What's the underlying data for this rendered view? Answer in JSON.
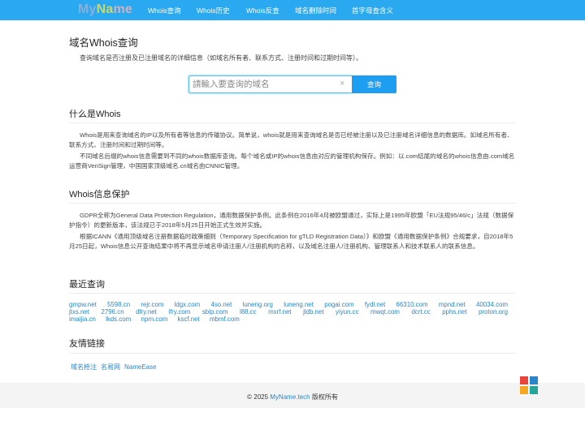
{
  "header": {
    "logo_parts": [
      "My",
      "Na",
      "me"
    ],
    "nav": [
      "Whois查询",
      "Whois历史",
      "Whois反查",
      "域名删除时间",
      "首字母查含义"
    ]
  },
  "page": {
    "title": "域名Whois查询",
    "description": "查询域名是否注册及已注册域名的详细信息（如域名所有者、联系方式、注册时间和过期时间等）。"
  },
  "search": {
    "placeholder": "請輸入要查询的域名",
    "value": "",
    "clear_glyph": "×",
    "button_label": "查询"
  },
  "about": {
    "title": "什么是Whois",
    "paragraphs": [
      "Whois是用来查询域名的IP以及所有者等信息的传输协议。简单说，whois就是用来查询域名是否已经被注册以及已注册域名详细信息的数据库。如域名所有者、联系方式、注册时间和过期时间等。",
      "不同域名后缀的whois信息需要到不同的whois数据库查询。每个域名或IP的whois信息由对应的管理机构保存。例如：以.com结尾的域名的whois信息由.com域名运营商VeriSign管理，中国国家顶级域名.cn域名由CNNIC管理。"
    ]
  },
  "privacy": {
    "title": "Whois信息保护",
    "paragraphs": [
      "GDPR全称为General Data Protection Regulation，通用数据保护条例。此条例在2016年4月被欧盟通过，实际上是1995年欧盟「EU法规95/46/c」法规（数据保护指令）的更新版本，该法规已于2018年5月25日开始正式生效并实施。",
      "根据ICANN《通用顶级域名注册数据临时政策细则（Temporary Specification for gTLD Registration Data）》和欧盟《通用数据保护条例》合规要求，自2018年5月25日起，Whois信息公开查询结果中将不再显示域名申请注册人/注册机构的名称，以及域名注册人/注册机构、管理联系人和技术联系人的联系信息。"
    ]
  },
  "recent": {
    "title": "最近查询",
    "domains": [
      "gmpw.net",
      "5598.cn",
      "rejr.com",
      "ldgx.com",
      "4so.net",
      "luneng.org",
      "luneng.net",
      "pogai.com",
      "fydl.net",
      "66310.com",
      "mpnd.net",
      "40034.com",
      "jtxs.net",
      "2796.cn",
      "dfry.net",
      "lfry.com",
      "sblp.com",
      "l88.cc",
      "mxrf.net",
      "jldb.net",
      "yiyun.cc",
      "mwqt.com",
      "dcrt.cc",
      "pphs.net",
      "proton.org",
      "imaijia.cn",
      "lkds.com",
      "nprn.com",
      "kscf.net",
      "mbmf.com"
    ]
  },
  "friends": {
    "title": "友情链接",
    "links": [
      "域名抢注",
      "名易网",
      "NameEase"
    ]
  },
  "footer": {
    "prefix": "© 2025 ",
    "site": "MyName.tech",
    "suffix": " 版权所有"
  },
  "widget": {
    "icon": "grid-icon",
    "colors": [
      "#e8453c",
      "#2a86c8",
      "#f5a623",
      "#26a69a"
    ]
  },
  "colors": {
    "nav_bg": "#2aa8f0",
    "button_bg": "#1e9ef0",
    "link": "#2a86c8"
  }
}
